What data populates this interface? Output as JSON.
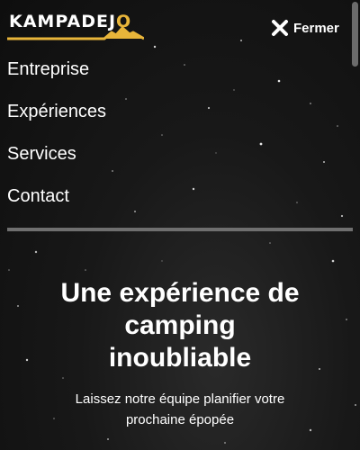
{
  "brand": {
    "name_main": "KAMPADEJ",
    "name_accent": "O",
    "accent_color": "#e8b53a"
  },
  "header": {
    "close_label": "Fermer",
    "close_icon": "close-icon"
  },
  "nav": {
    "items": [
      {
        "label": "Entreprise"
      },
      {
        "label": "Expériences"
      },
      {
        "label": "Services"
      },
      {
        "label": "Contact"
      }
    ]
  },
  "hero": {
    "title_line1": "Une expérience de",
    "title_line2": "camping",
    "title_line3": "inoubliable",
    "subtitle_line1": "Laissez notre équipe planifier votre",
    "subtitle_line2": "prochaine épopée"
  },
  "colors": {
    "background": "#121212",
    "divider": "#6f6f6f",
    "text": "#ffffff"
  }
}
